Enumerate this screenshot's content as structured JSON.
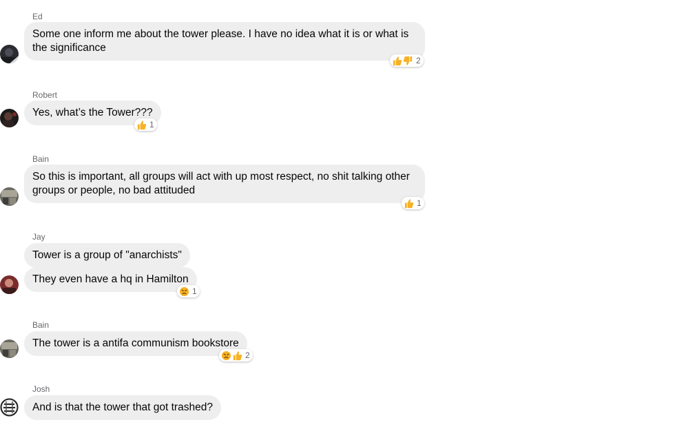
{
  "messages": [
    {
      "author": "Ed",
      "bubbles": [
        "Some one inform me about the tower please. I have no idea what it is or what is the significance"
      ],
      "reactions": {
        "icons": [
          "thumbs-up-icon",
          "thumbs-down-icon"
        ],
        "count": "2"
      }
    },
    {
      "author": "Robert",
      "bubbles": [
        "Yes, what’s the Tower???"
      ],
      "reactions": {
        "icons": [
          "thumbs-up-icon"
        ],
        "count": "1"
      }
    },
    {
      "author": "Bain",
      "bubbles": [
        "So this is important, all groups will act with up most respect, no shit talking other groups or people, no bad attituded"
      ],
      "reactions": {
        "icons": [
          "thumbs-up-icon"
        ],
        "count": "1"
      }
    },
    {
      "author": "Jay",
      "bubbles": [
        "Tower is a group of \"anarchists\"",
        "They even have a hq in Hamilton"
      ],
      "reactions": {
        "icons": [
          "angry-face-icon"
        ],
        "count": "1"
      }
    },
    {
      "author": "Bain",
      "bubbles": [
        "The tower is a antifa communism bookstore"
      ],
      "reactions": {
        "icons": [
          "angry-face-icon",
          "thumbs-up-icon"
        ],
        "count": "2"
      }
    },
    {
      "author": "Josh",
      "bubbles": [
        "And is that the tower that got trashed?"
      ]
    }
  ],
  "colors": {
    "bubble": "#efeeee",
    "name": "#65676b",
    "text": "#050505",
    "reaction_yellow": "#f7b125"
  }
}
